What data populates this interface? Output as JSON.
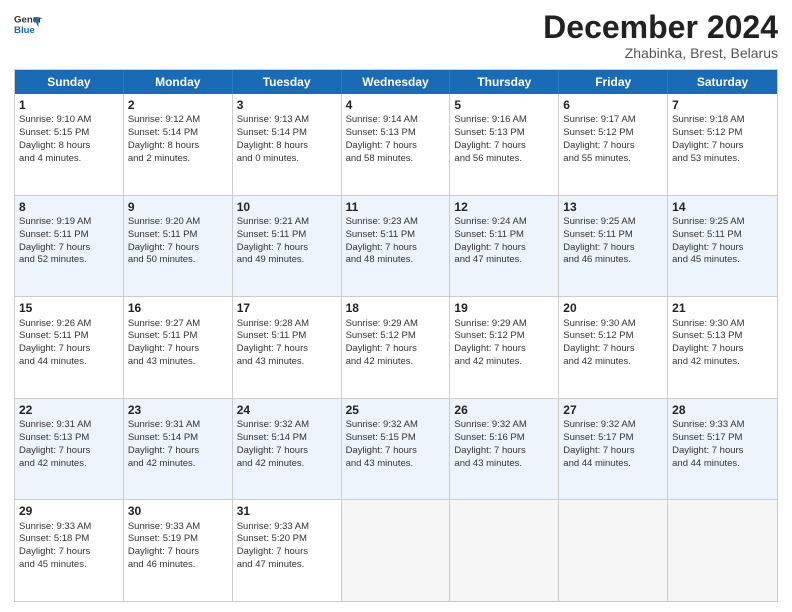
{
  "header": {
    "logo_line1": "General",
    "logo_line2": "Blue",
    "title": "December 2024",
    "location": "Zhabinka, Brest, Belarus"
  },
  "days_of_week": [
    "Sunday",
    "Monday",
    "Tuesday",
    "Wednesday",
    "Thursday",
    "Friday",
    "Saturday"
  ],
  "rows": [
    {
      "alt": false,
      "cells": [
        {
          "day": "1",
          "lines": [
            "Sunrise: 9:10 AM",
            "Sunset: 5:15 PM",
            "Daylight: 8 hours",
            "and 4 minutes."
          ]
        },
        {
          "day": "2",
          "lines": [
            "Sunrise: 9:12 AM",
            "Sunset: 5:14 PM",
            "Daylight: 8 hours",
            "and 2 minutes."
          ]
        },
        {
          "day": "3",
          "lines": [
            "Sunrise: 9:13 AM",
            "Sunset: 5:14 PM",
            "Daylight: 8 hours",
            "and 0 minutes."
          ]
        },
        {
          "day": "4",
          "lines": [
            "Sunrise: 9:14 AM",
            "Sunset: 5:13 PM",
            "Daylight: 7 hours",
            "and 58 minutes."
          ]
        },
        {
          "day": "5",
          "lines": [
            "Sunrise: 9:16 AM",
            "Sunset: 5:13 PM",
            "Daylight: 7 hours",
            "and 56 minutes."
          ]
        },
        {
          "day": "6",
          "lines": [
            "Sunrise: 9:17 AM",
            "Sunset: 5:12 PM",
            "Daylight: 7 hours",
            "and 55 minutes."
          ]
        },
        {
          "day": "7",
          "lines": [
            "Sunrise: 9:18 AM",
            "Sunset: 5:12 PM",
            "Daylight: 7 hours",
            "and 53 minutes."
          ]
        }
      ]
    },
    {
      "alt": true,
      "cells": [
        {
          "day": "8",
          "lines": [
            "Sunrise: 9:19 AM",
            "Sunset: 5:11 PM",
            "Daylight: 7 hours",
            "and 52 minutes."
          ]
        },
        {
          "day": "9",
          "lines": [
            "Sunrise: 9:20 AM",
            "Sunset: 5:11 PM",
            "Daylight: 7 hours",
            "and 50 minutes."
          ]
        },
        {
          "day": "10",
          "lines": [
            "Sunrise: 9:21 AM",
            "Sunset: 5:11 PM",
            "Daylight: 7 hours",
            "and 49 minutes."
          ]
        },
        {
          "day": "11",
          "lines": [
            "Sunrise: 9:23 AM",
            "Sunset: 5:11 PM",
            "Daylight: 7 hours",
            "and 48 minutes."
          ]
        },
        {
          "day": "12",
          "lines": [
            "Sunrise: 9:24 AM",
            "Sunset: 5:11 PM",
            "Daylight: 7 hours",
            "and 47 minutes."
          ]
        },
        {
          "day": "13",
          "lines": [
            "Sunrise: 9:25 AM",
            "Sunset: 5:11 PM",
            "Daylight: 7 hours",
            "and 46 minutes."
          ]
        },
        {
          "day": "14",
          "lines": [
            "Sunrise: 9:25 AM",
            "Sunset: 5:11 PM",
            "Daylight: 7 hours",
            "and 45 minutes."
          ]
        }
      ]
    },
    {
      "alt": false,
      "cells": [
        {
          "day": "15",
          "lines": [
            "Sunrise: 9:26 AM",
            "Sunset: 5:11 PM",
            "Daylight: 7 hours",
            "and 44 minutes."
          ]
        },
        {
          "day": "16",
          "lines": [
            "Sunrise: 9:27 AM",
            "Sunset: 5:11 PM",
            "Daylight: 7 hours",
            "and 43 minutes."
          ]
        },
        {
          "day": "17",
          "lines": [
            "Sunrise: 9:28 AM",
            "Sunset: 5:11 PM",
            "Daylight: 7 hours",
            "and 43 minutes."
          ]
        },
        {
          "day": "18",
          "lines": [
            "Sunrise: 9:29 AM",
            "Sunset: 5:12 PM",
            "Daylight: 7 hours",
            "and 42 minutes."
          ]
        },
        {
          "day": "19",
          "lines": [
            "Sunrise: 9:29 AM",
            "Sunset: 5:12 PM",
            "Daylight: 7 hours",
            "and 42 minutes."
          ]
        },
        {
          "day": "20",
          "lines": [
            "Sunrise: 9:30 AM",
            "Sunset: 5:12 PM",
            "Daylight: 7 hours",
            "and 42 minutes."
          ]
        },
        {
          "day": "21",
          "lines": [
            "Sunrise: 9:30 AM",
            "Sunset: 5:13 PM",
            "Daylight: 7 hours",
            "and 42 minutes."
          ]
        }
      ]
    },
    {
      "alt": true,
      "cells": [
        {
          "day": "22",
          "lines": [
            "Sunrise: 9:31 AM",
            "Sunset: 5:13 PM",
            "Daylight: 7 hours",
            "and 42 minutes."
          ]
        },
        {
          "day": "23",
          "lines": [
            "Sunrise: 9:31 AM",
            "Sunset: 5:14 PM",
            "Daylight: 7 hours",
            "and 42 minutes."
          ]
        },
        {
          "day": "24",
          "lines": [
            "Sunrise: 9:32 AM",
            "Sunset: 5:14 PM",
            "Daylight: 7 hours",
            "and 42 minutes."
          ]
        },
        {
          "day": "25",
          "lines": [
            "Sunrise: 9:32 AM",
            "Sunset: 5:15 PM",
            "Daylight: 7 hours",
            "and 43 minutes."
          ]
        },
        {
          "day": "26",
          "lines": [
            "Sunrise: 9:32 AM",
            "Sunset: 5:16 PM",
            "Daylight: 7 hours",
            "and 43 minutes."
          ]
        },
        {
          "day": "27",
          "lines": [
            "Sunrise: 9:32 AM",
            "Sunset: 5:17 PM",
            "Daylight: 7 hours",
            "and 44 minutes."
          ]
        },
        {
          "day": "28",
          "lines": [
            "Sunrise: 9:33 AM",
            "Sunset: 5:17 PM",
            "Daylight: 7 hours",
            "and 44 minutes."
          ]
        }
      ]
    },
    {
      "alt": false,
      "cells": [
        {
          "day": "29",
          "lines": [
            "Sunrise: 9:33 AM",
            "Sunset: 5:18 PM",
            "Daylight: 7 hours",
            "and 45 minutes."
          ]
        },
        {
          "day": "30",
          "lines": [
            "Sunrise: 9:33 AM",
            "Sunset: 5:19 PM",
            "Daylight: 7 hours",
            "and 46 minutes."
          ]
        },
        {
          "day": "31",
          "lines": [
            "Sunrise: 9:33 AM",
            "Sunset: 5:20 PM",
            "Daylight: 7 hours",
            "and 47 minutes."
          ]
        },
        {
          "day": "",
          "lines": []
        },
        {
          "day": "",
          "lines": []
        },
        {
          "day": "",
          "lines": []
        },
        {
          "day": "",
          "lines": []
        }
      ]
    }
  ]
}
